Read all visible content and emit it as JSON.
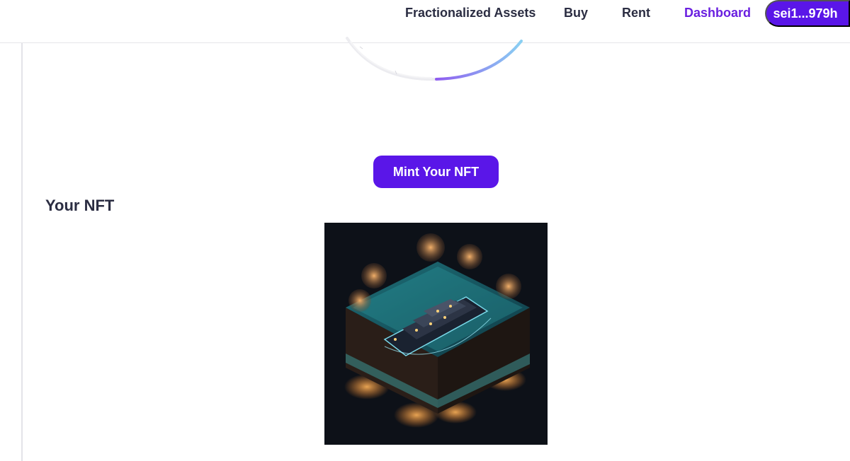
{
  "nav": {
    "items": [
      {
        "label": "Fractionalized Assets",
        "active": false
      },
      {
        "label": "Buy",
        "active": false
      },
      {
        "label": "Rent",
        "active": false
      },
      {
        "label": "Dashboard",
        "active": true
      }
    ],
    "wallet_label": "sei1...979h"
  },
  "main": {
    "mint_button_label": "Mint Your NFT",
    "section_title": "Your NFT",
    "nft_image_icon": "nft-yacht-diorama-image"
  },
  "colors": {
    "accent": "#5a16e8",
    "active_nav": "#6a1fe0",
    "text": "#2b2d42"
  }
}
